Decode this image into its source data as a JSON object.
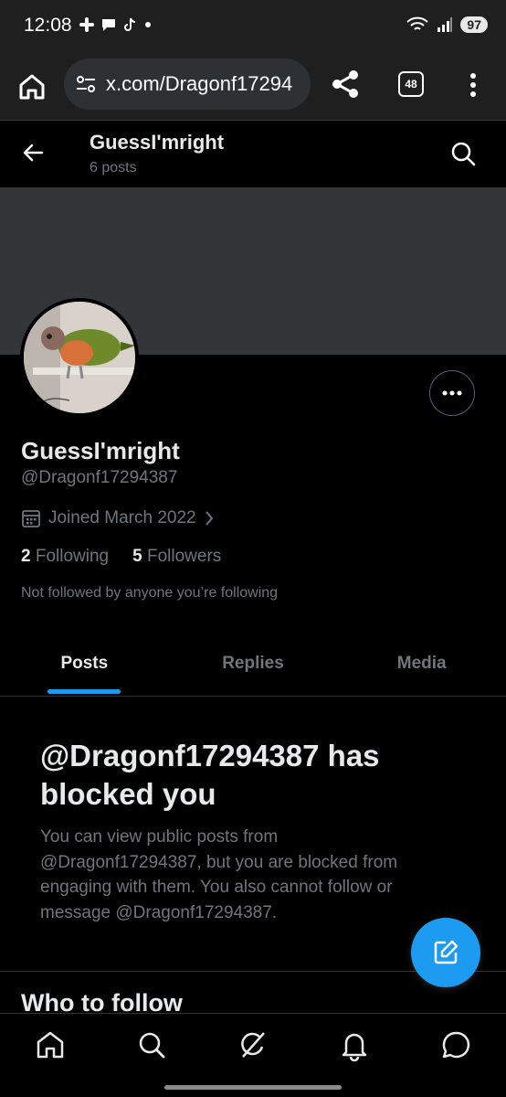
{
  "status_bar": {
    "time": "12:08",
    "battery": "97"
  },
  "browser": {
    "url": "x.com/Dragonf17294",
    "tab_count": "48"
  },
  "header": {
    "name": "GuessI'mright",
    "posts": "6 posts"
  },
  "profile": {
    "name": "GuessI'mright",
    "handle": "@Dragonf17294387",
    "joined": "Joined March 2022",
    "following_count": "2",
    "following_label": "Following",
    "followers_count": "5",
    "followers_label": "Followers",
    "not_followed": "Not followed by anyone you’re following"
  },
  "tabs": [
    {
      "label": "Posts",
      "active": true
    },
    {
      "label": "Replies",
      "active": false
    },
    {
      "label": "Media",
      "active": false
    }
  ],
  "blocked": {
    "title": "@Dragonf17294387 has blocked you",
    "body": "You can view public posts from @Dragonf17294387, but you are blocked from engaging with them. You also cannot follow or message @Dragonf17294387."
  },
  "who_to_follow": "Who to follow",
  "colors": {
    "accent": "#1d9bf0",
    "background": "#000000",
    "muted_text": "#71767b"
  },
  "icons": [
    "home-icon",
    "search-icon",
    "grok-icon",
    "notifications-icon",
    "messages-icon",
    "compose-icon"
  ]
}
